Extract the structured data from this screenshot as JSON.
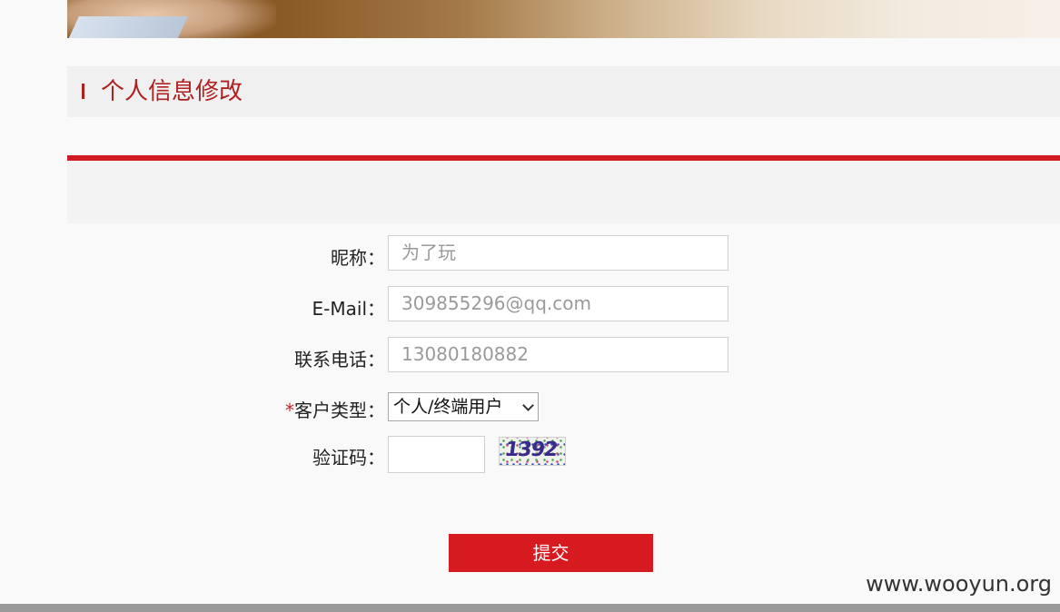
{
  "section": {
    "title": "个人信息修改"
  },
  "form": {
    "nickname": {
      "label": "昵称：",
      "value": "为了玩"
    },
    "email": {
      "label": "E-Mail：",
      "value": "309855296@qq.com"
    },
    "phone": {
      "label": "联系电话：",
      "value": "13080180882"
    },
    "customer_type": {
      "required_mark": "*",
      "label": "客户类型：",
      "selected": "个人/终端用户"
    },
    "captcha": {
      "label": "验证码：",
      "value": "",
      "image_text": "1392"
    },
    "submit_label": "提交"
  },
  "watermark": "www.wooyun.org",
  "colors": {
    "accent": "#d71920",
    "title": "#b02020"
  }
}
